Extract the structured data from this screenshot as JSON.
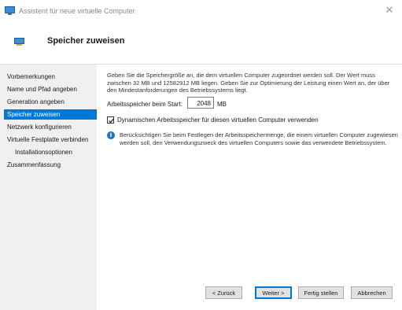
{
  "window": {
    "title": "Assistent für neue virtuelle Computer",
    "close_icon": "close-icon"
  },
  "header": {
    "title": "Speicher zuweisen"
  },
  "sidebar": {
    "items": [
      {
        "label": "Vorbemerkungen",
        "active": false
      },
      {
        "label": "Name und Pfad angeben",
        "active": false
      },
      {
        "label": "Generation angeben",
        "active": false
      },
      {
        "label": "Speicher zuweisen",
        "active": true
      },
      {
        "label": "Netzwerk konfigurieren",
        "active": false
      },
      {
        "label": "Virtuelle Festplatte verbinden",
        "active": false
      },
      {
        "label": "Installationsoptionen",
        "active": false,
        "sub": true
      },
      {
        "label": "Zusammenfassung",
        "active": false
      }
    ],
    "active_color": "#0078d7"
  },
  "main": {
    "description": "Geben Sie die Speichergröße an, die dem virtuellen Computer zugeordnet werden soll. Der Wert muss zwischen 32 MB und 12582912 MB liegen. Geben Sie zur Optimierung der Leistung einen Wert an, der über den Mindestanforderungen des Betriebssystems liegt.",
    "memory_label": "Arbeitsspeicher beim Start:",
    "memory_value": "2048",
    "memory_unit": "MB",
    "dynamic_memory_label": "Dynamischen Arbeitsspeicher für diesen virtuellen Computer verwenden",
    "dynamic_memory_checked": true,
    "info_text": "Berücksichtigen Sie beim Festlegen der Arbeitsspeichermenge, die einem virtuellen Computer zugewiesen werden soll, den Verwendungszweck des virtuellen Computers sowie das verwendete Betriebssystem."
  },
  "footer": {
    "back_label": "< Zurück",
    "next_label": "Weiter >",
    "finish_label": "Fertig stellen",
    "cancel_label": "Abbrechen"
  }
}
